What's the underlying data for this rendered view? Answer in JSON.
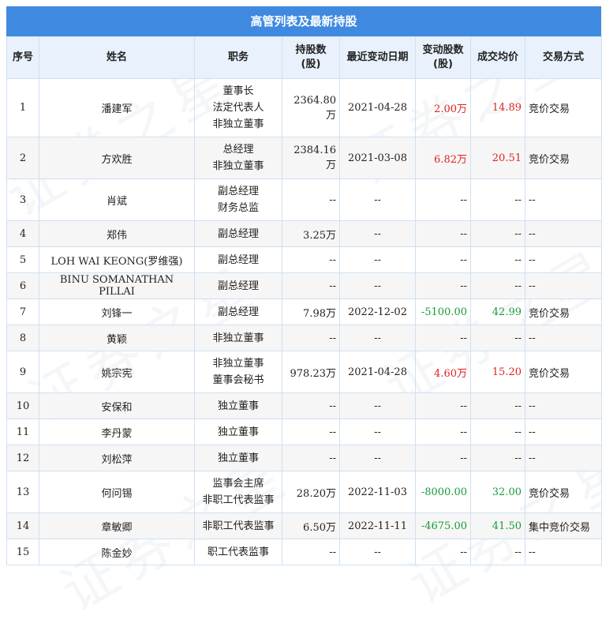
{
  "title": "高管列表及最新持股",
  "headers": {
    "seq": "序号",
    "name": "姓名",
    "position": "职务",
    "shares_l1": "持股数",
    "shares_l2": "(股)",
    "date": "最近变动日期",
    "change_l1": "变动股数",
    "change_l2": "(股)",
    "price": "成交均价",
    "method": "交易方式"
  },
  "watermark": "证券之星",
  "colors": {
    "header_bar": "#3f8ae0",
    "increase": "#e02222",
    "decrease": "#1a9a3a"
  },
  "rows": [
    {
      "seq": "1",
      "name": "潘建军",
      "positions": [
        "董事长",
        "法定代表人",
        "非独立董事"
      ],
      "shares": "2364.80万",
      "date": "2021-04-28",
      "change": "2.00万",
      "price": "14.89",
      "method": "竞价交易",
      "color": "red"
    },
    {
      "seq": "2",
      "name": "方欢胜",
      "positions": [
        "总经理",
        "非独立董事"
      ],
      "shares": "2384.16万",
      "date": "2021-03-08",
      "change": "6.82万",
      "price": "20.51",
      "method": "竞价交易",
      "color": "red"
    },
    {
      "seq": "3",
      "name": "肖斌",
      "positions": [
        "副总经理",
        "财务总监"
      ],
      "shares": "--",
      "date": "--",
      "change": "--",
      "price": "--",
      "method": "--",
      "color": ""
    },
    {
      "seq": "4",
      "name": "郑伟",
      "positions": [
        "副总经理"
      ],
      "shares": "3.25万",
      "date": "--",
      "change": "--",
      "price": "--",
      "method": "--",
      "color": ""
    },
    {
      "seq": "5",
      "name": "LOH WAI KEONG(罗维强)",
      "positions": [
        "副总经理"
      ],
      "shares": "--",
      "date": "--",
      "change": "--",
      "price": "--",
      "method": "--",
      "color": ""
    },
    {
      "seq": "6",
      "name": "BINU SOMANATHAN PILLAI",
      "positions": [
        "副总经理"
      ],
      "shares": "--",
      "date": "--",
      "change": "--",
      "price": "--",
      "method": "--",
      "color": ""
    },
    {
      "seq": "7",
      "name": "刘锋一",
      "positions": [
        "副总经理"
      ],
      "shares": "7.98万",
      "date": "2022-12-02",
      "change": "-5100.00",
      "price": "42.99",
      "method": "竞价交易",
      "color": "green"
    },
    {
      "seq": "8",
      "name": "黄颖",
      "positions": [
        "非独立董事"
      ],
      "shares": "--",
      "date": "--",
      "change": "--",
      "price": "--",
      "method": "--",
      "color": ""
    },
    {
      "seq": "9",
      "name": "姚宗宪",
      "positions": [
        "非独立董事",
        "董事会秘书"
      ],
      "shares": "978.23万",
      "date": "2021-04-28",
      "change": "4.60万",
      "price": "15.20",
      "method": "竞价交易",
      "color": "red"
    },
    {
      "seq": "10",
      "name": "安保和",
      "positions": [
        "独立董事"
      ],
      "shares": "--",
      "date": "--",
      "change": "--",
      "price": "--",
      "method": "--",
      "color": ""
    },
    {
      "seq": "11",
      "name": "李丹蒙",
      "positions": [
        "独立董事"
      ],
      "shares": "--",
      "date": "--",
      "change": "--",
      "price": "--",
      "method": "--",
      "color": ""
    },
    {
      "seq": "12",
      "name": "刘松萍",
      "positions": [
        "独立董事"
      ],
      "shares": "--",
      "date": "--",
      "change": "--",
      "price": "--",
      "method": "--",
      "color": ""
    },
    {
      "seq": "13",
      "name": "何问锡",
      "positions": [
        "监事会主席",
        "非职工代表监事"
      ],
      "shares": "28.20万",
      "date": "2022-11-03",
      "change": "-8000.00",
      "price": "32.00",
      "method": "竞价交易",
      "color": "green"
    },
    {
      "seq": "14",
      "name": "章敏卿",
      "positions": [
        "非职工代表监事"
      ],
      "shares": "6.50万",
      "date": "2022-11-11",
      "change": "-4675.00",
      "price": "41.50",
      "method": "集中竞价交易",
      "color": "green"
    },
    {
      "seq": "15",
      "name": "陈金妙",
      "positions": [
        "职工代表监事"
      ],
      "shares": "--",
      "date": "--",
      "change": "--",
      "price": "--",
      "method": "--",
      "color": ""
    }
  ]
}
